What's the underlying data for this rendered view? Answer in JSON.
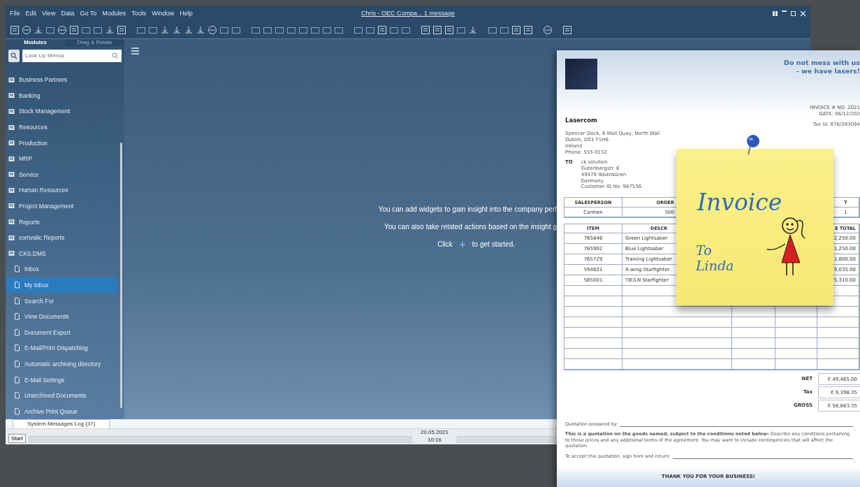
{
  "window": {
    "title": "Chris - OEC Compa... 1 message"
  },
  "menu_bar": {
    "items": [
      "File",
      "Edit",
      "View",
      "Data",
      "Go To",
      "Modules",
      "Tools",
      "Window",
      "Help"
    ]
  },
  "sidebar": {
    "tabs": [
      {
        "label": "Modules",
        "selected": true
      },
      {
        "label": "Drag & Relate",
        "selected": false
      }
    ],
    "search": {
      "placeholder": "Look Up Menus"
    },
    "items": [
      {
        "label": "Business Partners",
        "selected": false
      },
      {
        "label": "Banking",
        "selected": false
      },
      {
        "label": "Stock Management",
        "selected": false
      },
      {
        "label": "Resources",
        "selected": false
      },
      {
        "label": "Production",
        "selected": false
      },
      {
        "label": "MRP",
        "selected": false
      },
      {
        "label": "Service",
        "selected": false
      },
      {
        "label": "Human Resources",
        "selected": false
      },
      {
        "label": "Project Management",
        "selected": false
      },
      {
        "label": "Reports",
        "selected": false
      },
      {
        "label": "comvalic Reports",
        "selected": false
      },
      {
        "label": "CKS.DMS",
        "selected": false,
        "children": [
          {
            "label": "Inbox",
            "selected": false
          },
          {
            "label": "My Inbox",
            "selected": true
          },
          {
            "label": "Search For",
            "selected": false
          },
          {
            "label": "View Documents",
            "selected": false
          },
          {
            "label": "Document Export",
            "selected": false
          },
          {
            "label": "E-Mail/Print Dispatching",
            "selected": false
          },
          {
            "label": "Automatic archiving directory",
            "selected": false
          },
          {
            "label": "E-Mail Settings",
            "selected": false
          },
          {
            "label": "Unarchived Documents",
            "selected": false
          },
          {
            "label": "Archive Print Queue",
            "selected": false
          }
        ]
      }
    ]
  },
  "main": {
    "messages": [
      "You can add widgets to gain insight into the company perf",
      "You can also take related actions based on the insight g"
    ],
    "cta": {
      "before": "Click",
      "after": "to get started."
    }
  },
  "bottom_tabs": [
    {
      "label": "System Messages Log (37)",
      "selected": true
    }
  ],
  "status_bar": {
    "start": "Start",
    "date": "20.05.2021",
    "time": "10:16"
  },
  "invoice": {
    "slogan": [
      "Do not mess with us",
      "- we have lasers!"
    ],
    "company": "Lasercom",
    "address": [
      "Spencer Dock, 6 Wall Quay, North Wall",
      "Dublin, D01 T1H6",
      "Ireland",
      "Phone: 555-0132"
    ],
    "meta": [
      "INVOICE # NO. 2021",
      "DATE: 06/12/202"
    ],
    "tax_id": "Tax Id: 876/283094",
    "to_label": "TO",
    "recipient": [
      "ck.solution",
      "Gutenbergstr. 6",
      "49479 Ibbenbüren",
      "Germany",
      "Customer ID No. 987536"
    ],
    "order_table": {
      "columns": [
        "SALESPERSON",
        "ORDER",
        "T"
      ],
      "rows": [
        [
          "Carmen",
          "500",
          "1"
        ]
      ]
    },
    "items_table": {
      "columns": [
        "ITEM",
        "DESCR",
        "E TOTAL"
      ],
      "rows": [
        [
          "765846",
          "Green Lightsaber",
          "2,250.00"
        ],
        [
          "765902",
          "Blue Lightsaber",
          "1,250.00"
        ],
        [
          "765729",
          "Training Lightsaber",
          "1,800.00"
        ],
        [
          "594821",
          "X-wing Starfighter",
          "9,035.00"
        ],
        [
          "585001",
          "TIE/LN Starfighter",
          "5,310.00"
        ]
      ]
    },
    "totals": [
      {
        "label": "NET",
        "value": "€ 49,465.00"
      },
      {
        "label": "Tax",
        "value": "€ 9,398.35"
      },
      {
        "label": "GROSS",
        "value": "€ 58,863.35"
      }
    ],
    "prepared_by": "Quotation prepared by:",
    "terms": "**This is a quotation on the goods named, subject to the conditions noted below:** Describe any conditions pertaining to these prices and any additional terms of the agreement. You may want to include contingencies that will affect the quotation.",
    "accept": "To accept this quotation, sign here and return:",
    "thanks": "THANK YOU FOR YOUR BUSINESS!",
    "note": {
      "title": "Invoice",
      "lines": [
        "To",
        "Linda"
      ]
    }
  }
}
